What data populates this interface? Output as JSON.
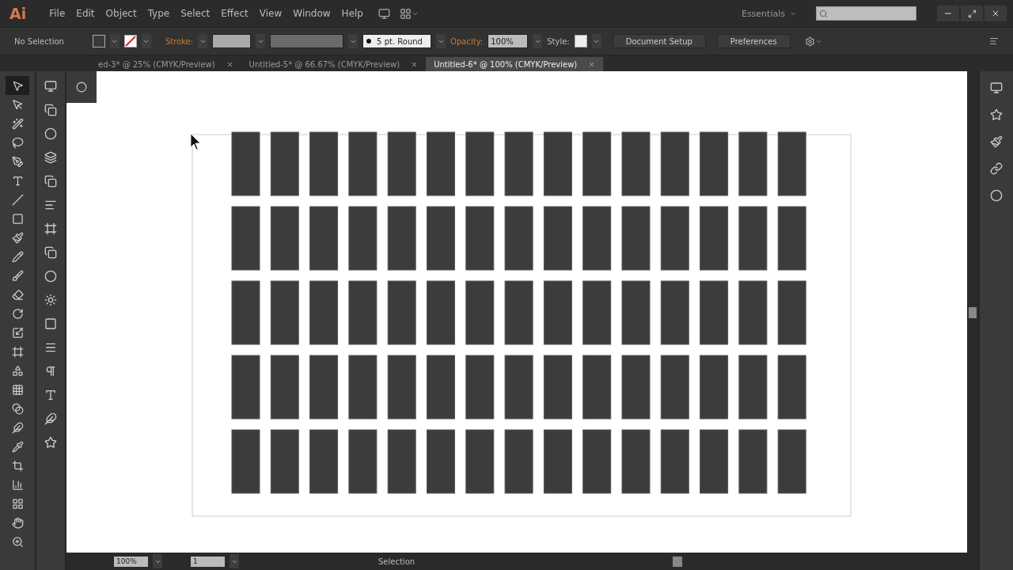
{
  "app": {
    "logo": "Ai",
    "menu": [
      "File",
      "Edit",
      "Object",
      "Type",
      "Select",
      "Effect",
      "View",
      "Window",
      "Help"
    ],
    "workspace": "Essentials"
  },
  "control_bar": {
    "selection": "No Selection",
    "stroke_label": "Stroke:",
    "brush": "5 pt. Round",
    "opacity_label": "Opacity:",
    "opacity": "100%",
    "style_label": "Style:",
    "buttons": [
      "Document Setup",
      "Preferences"
    ]
  },
  "tabs": [
    {
      "label": "ed-3* @ 25% (CMYK/Preview)",
      "selected": false
    },
    {
      "label": "Untitled-5* @ 66.67% (CMYK/Preview)",
      "selected": false
    },
    {
      "label": "Untitled-6* @ 100% (CMYK/Preview)",
      "selected": true
    }
  ],
  "tools": [
    {
      "selected": true
    },
    {
      "selected": false
    },
    {
      "selected": false
    },
    {
      "selected": false
    },
    {
      "selected": false
    },
    {
      "selected": false
    },
    {
      "selected": false
    },
    {
      "selected": false
    },
    {
      "selected": false
    },
    {
      "selected": false
    },
    {
      "selected": false
    },
    {
      "selected": false
    },
    {
      "selected": false
    },
    {
      "selected": false
    },
    {
      "selected": false
    },
    {
      "selected": false
    },
    {
      "selected": false
    },
    {
      "selected": false
    },
    {
      "selected": false
    },
    {
      "selected": false
    },
    {
      "selected": false
    },
    {
      "selected": false
    },
    {
      "selected": false
    },
    {
      "selected": false
    },
    {
      "selected": false
    }
  ],
  "status_bar": {
    "zoom": "100%",
    "artboard": "1",
    "tool": "Selection"
  }
}
